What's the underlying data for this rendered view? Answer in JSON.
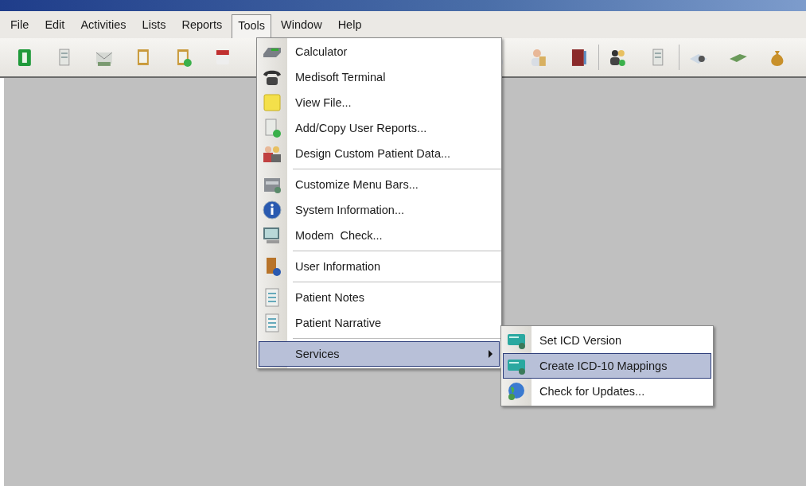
{
  "menubar": [
    {
      "label": "File",
      "selected": false
    },
    {
      "label": "Edit",
      "selected": false
    },
    {
      "label": "Activities",
      "selected": false
    },
    {
      "label": "Lists",
      "selected": false
    },
    {
      "label": "Reports",
      "selected": false
    },
    {
      "label": "Tools",
      "selected": true
    },
    {
      "label": "Window",
      "selected": false
    },
    {
      "label": "Help",
      "selected": false
    }
  ],
  "tools_menu": {
    "groups": [
      [
        {
          "label": "Calculator",
          "selected": false,
          "submenu": false
        },
        {
          "label": "Medisoft Terminal",
          "selected": false,
          "submenu": false
        },
        {
          "label": "View File...",
          "selected": false,
          "submenu": false
        },
        {
          "label": "Add/Copy User Reports...",
          "selected": false,
          "submenu": false
        },
        {
          "label": "Design Custom Patient Data...",
          "selected": false,
          "submenu": false
        }
      ],
      [
        {
          "label": "Customize Menu Bars...",
          "selected": false,
          "submenu": false
        },
        {
          "label": "System Information...",
          "selected": false,
          "submenu": false
        },
        {
          "label": "Modem  Check...",
          "selected": false,
          "submenu": false
        }
      ],
      [
        {
          "label": "User Information",
          "selected": false,
          "submenu": false
        }
      ],
      [
        {
          "label": "Patient Notes",
          "selected": false,
          "submenu": false
        },
        {
          "label": "Patient Narrative",
          "selected": false,
          "submenu": false
        }
      ],
      [
        {
          "label": "Services",
          "selected": true,
          "submenu": true
        }
      ]
    ]
  },
  "services_submenu": {
    "items": [
      {
        "label": "Set ICD Version",
        "selected": false
      },
      {
        "label": "Create ICD-10 Mappings",
        "selected": true
      },
      {
        "label": "Check for Updates...",
        "selected": false
      }
    ]
  }
}
